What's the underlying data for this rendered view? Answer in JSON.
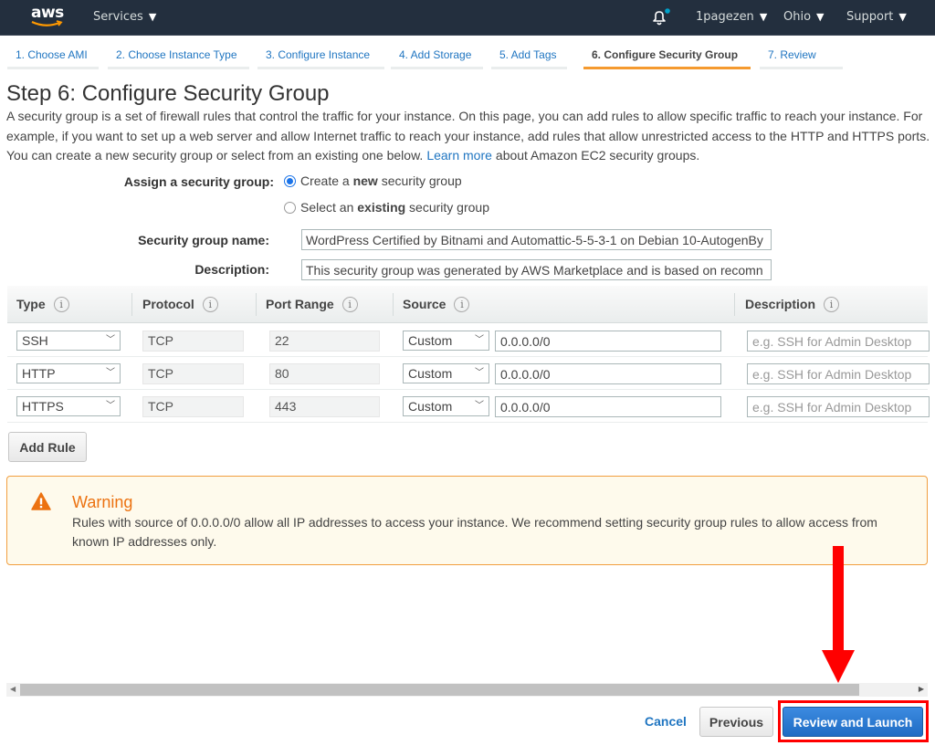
{
  "topnav": {
    "logo": "aws",
    "services": "Services",
    "account": "1pagezen",
    "region": "Ohio",
    "support": "Support",
    "notification_dot_color": "#00a1c9"
  },
  "wizard": {
    "tabs": [
      {
        "label": "1. Choose AMI",
        "active": false
      },
      {
        "label": "2. Choose Instance Type",
        "active": false
      },
      {
        "label": "3. Configure Instance",
        "active": false
      },
      {
        "label": "4. Add Storage",
        "active": false
      },
      {
        "label": "5. Add Tags",
        "active": false
      },
      {
        "label": "6. Configure Security Group",
        "active": true
      },
      {
        "label": "7. Review",
        "active": false
      }
    ]
  },
  "page": {
    "title": "Step 6: Configure Security Group",
    "intro_text": "A security group is a set of firewall rules that control the traffic for your instance. On this page, you can add rules to allow specific traffic to reach your instance. For example, if you want to set up a web server and allow Internet traffic to reach your instance, add rules that allow unrestricted access to the HTTP and HTTPS ports. You can create a new security group or select from an existing one below.",
    "learn_more": "Learn more",
    "intro_suffix": "about Amazon EC2 security groups."
  },
  "form": {
    "assign_label": "Assign a security group:",
    "option_new": {
      "prefix": "Create a ",
      "bold": "new",
      "suffix": " security group",
      "checked": true
    },
    "option_existing": {
      "prefix": "Select an ",
      "bold": "existing",
      "suffix": " security group",
      "checked": false
    },
    "name_label": "Security group name:",
    "name_value": "WordPress Certified by Bitnami and Automattic-5-5-3-1 on Debian 10-AutogenBy",
    "description_label": "Description:",
    "description_value": "This security group was generated by AWS Marketplace and is based on recomn"
  },
  "rules_table": {
    "headers": [
      "Type",
      "Protocol",
      "Port Range",
      "Source",
      "Description"
    ],
    "info_icon": "i",
    "description_placeholder": "e.g. SSH for Admin Desktop",
    "rows": [
      {
        "type": "SSH",
        "protocol": "TCP",
        "port_range": "22",
        "source_type": "Custom",
        "source": "0.0.0.0/0"
      },
      {
        "type": "HTTP",
        "protocol": "TCP",
        "port_range": "80",
        "source_type": "Custom",
        "source": "0.0.0.0/0"
      },
      {
        "type": "HTTPS",
        "protocol": "TCP",
        "port_range": "443",
        "source_type": "Custom",
        "source": "0.0.0.0/0"
      }
    ],
    "add_rule": "Add Rule"
  },
  "warning": {
    "title": "Warning",
    "text": "Rules with source of 0.0.0.0/0 allow all IP addresses to access your instance. We recommend setting security group rules to allow access from known IP addresses only."
  },
  "footer": {
    "cancel": "Cancel",
    "previous": "Previous",
    "review_and_launch": "Review and Launch"
  }
}
